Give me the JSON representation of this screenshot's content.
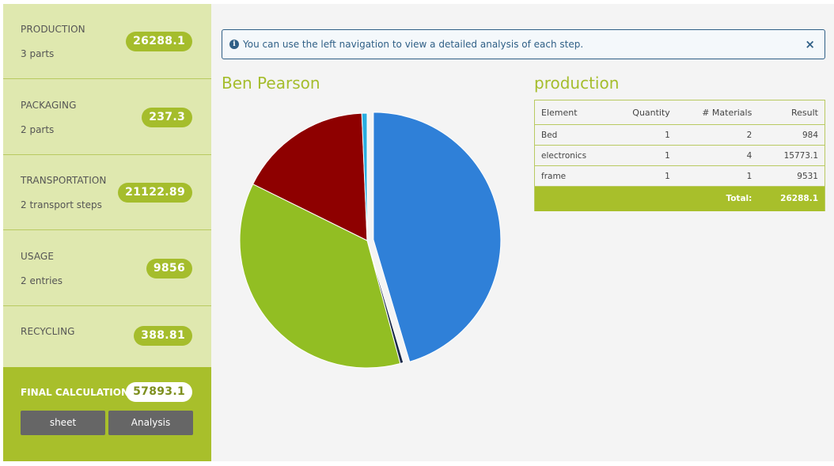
{
  "sidebar": {
    "items": [
      {
        "title": "PRODUCTION",
        "subtitle": "3 parts",
        "value": "26288.1"
      },
      {
        "title": "PACKAGING",
        "subtitle": "2 parts",
        "value": "237.3"
      },
      {
        "title": "TRANSPORTATION",
        "subtitle": "2 transport steps",
        "value": "21122.89"
      },
      {
        "title": "USAGE",
        "subtitle": "2 entries",
        "value": "9856"
      },
      {
        "title": "RECYCLING",
        "subtitle": "",
        "value": "388.81"
      }
    ],
    "final": {
      "title": "FINAL CALCULATION",
      "value": "57893.1",
      "sheet_label": "sheet",
      "analysis_label": "Analysis"
    }
  },
  "alert": {
    "icon": "info-icon",
    "message": "You can use the left navigation to view a detailed analysis of each step.",
    "close": "×"
  },
  "chart_title": "Ben Pearson",
  "chart_data": {
    "type": "pie",
    "title": "Ben Pearson",
    "series": [
      {
        "value": 26288.1,
        "color": "#2f80d8"
      },
      {
        "value": 237.3,
        "color": "#1a2a4a"
      },
      {
        "value": 21122.89,
        "color": "#92be23"
      },
      {
        "value": 9856,
        "color": "#8e0000"
      },
      {
        "value": 388.81,
        "color": "#29aee0"
      }
    ],
    "exploded_index": 0
  },
  "table": {
    "title": "production",
    "headers": [
      "Element",
      "Quantity",
      "# Materials",
      "Result"
    ],
    "rows": [
      [
        "Bed",
        "1",
        "2",
        "984"
      ],
      [
        "electronics",
        "1",
        "4",
        "15773.1"
      ],
      [
        "frame",
        "1",
        "1",
        "9531"
      ]
    ],
    "total_label": "Total:",
    "total_value": "26288.1"
  },
  "colors": {
    "accent": "#a5bd2c",
    "sidebar_bg": "#dfe8af",
    "alert_text": "#2f5f86"
  }
}
